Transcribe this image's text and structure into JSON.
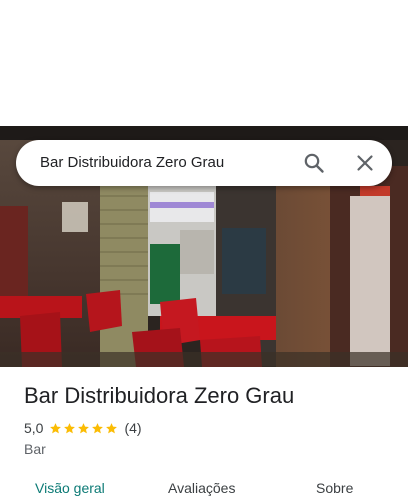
{
  "search": {
    "query": "Bar Distribuidora Zero Grau"
  },
  "place": {
    "name": "Bar Distribuidora Zero Grau",
    "rating": "5,0",
    "stars": 5,
    "review_count": "(4)",
    "category": "Bar"
  },
  "tabs": [
    {
      "label": "Visão geral",
      "active": true
    },
    {
      "label": "Avaliações",
      "active": false
    },
    {
      "label": "Sobre",
      "active": false
    }
  ],
  "colors": {
    "accent": "#0b7a75",
    "star": "#fbbc04",
    "text_primary": "#202124",
    "text_secondary": "#5f6368"
  },
  "icons": {
    "search": "search-icon",
    "close": "close-icon",
    "star": "star-icon"
  }
}
